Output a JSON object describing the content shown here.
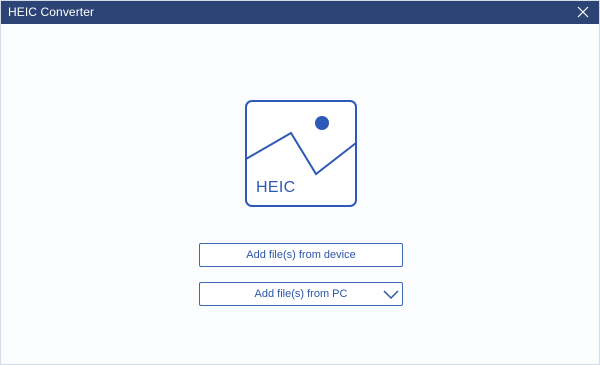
{
  "window": {
    "title": "HEIC Converter"
  },
  "icons": {
    "close": "close-icon",
    "image": "image-icon",
    "dropdown": "chevron-down-icon"
  },
  "main": {
    "hero_label": "HEIC",
    "add_device_label": "Add file(s) from device",
    "add_pc_label": "Add file(s) from PC"
  },
  "colors": {
    "titlebar": "#2c4375",
    "accent": "#2e59b8",
    "button_border": "#3f67b8",
    "background": "#fbfcfe"
  }
}
